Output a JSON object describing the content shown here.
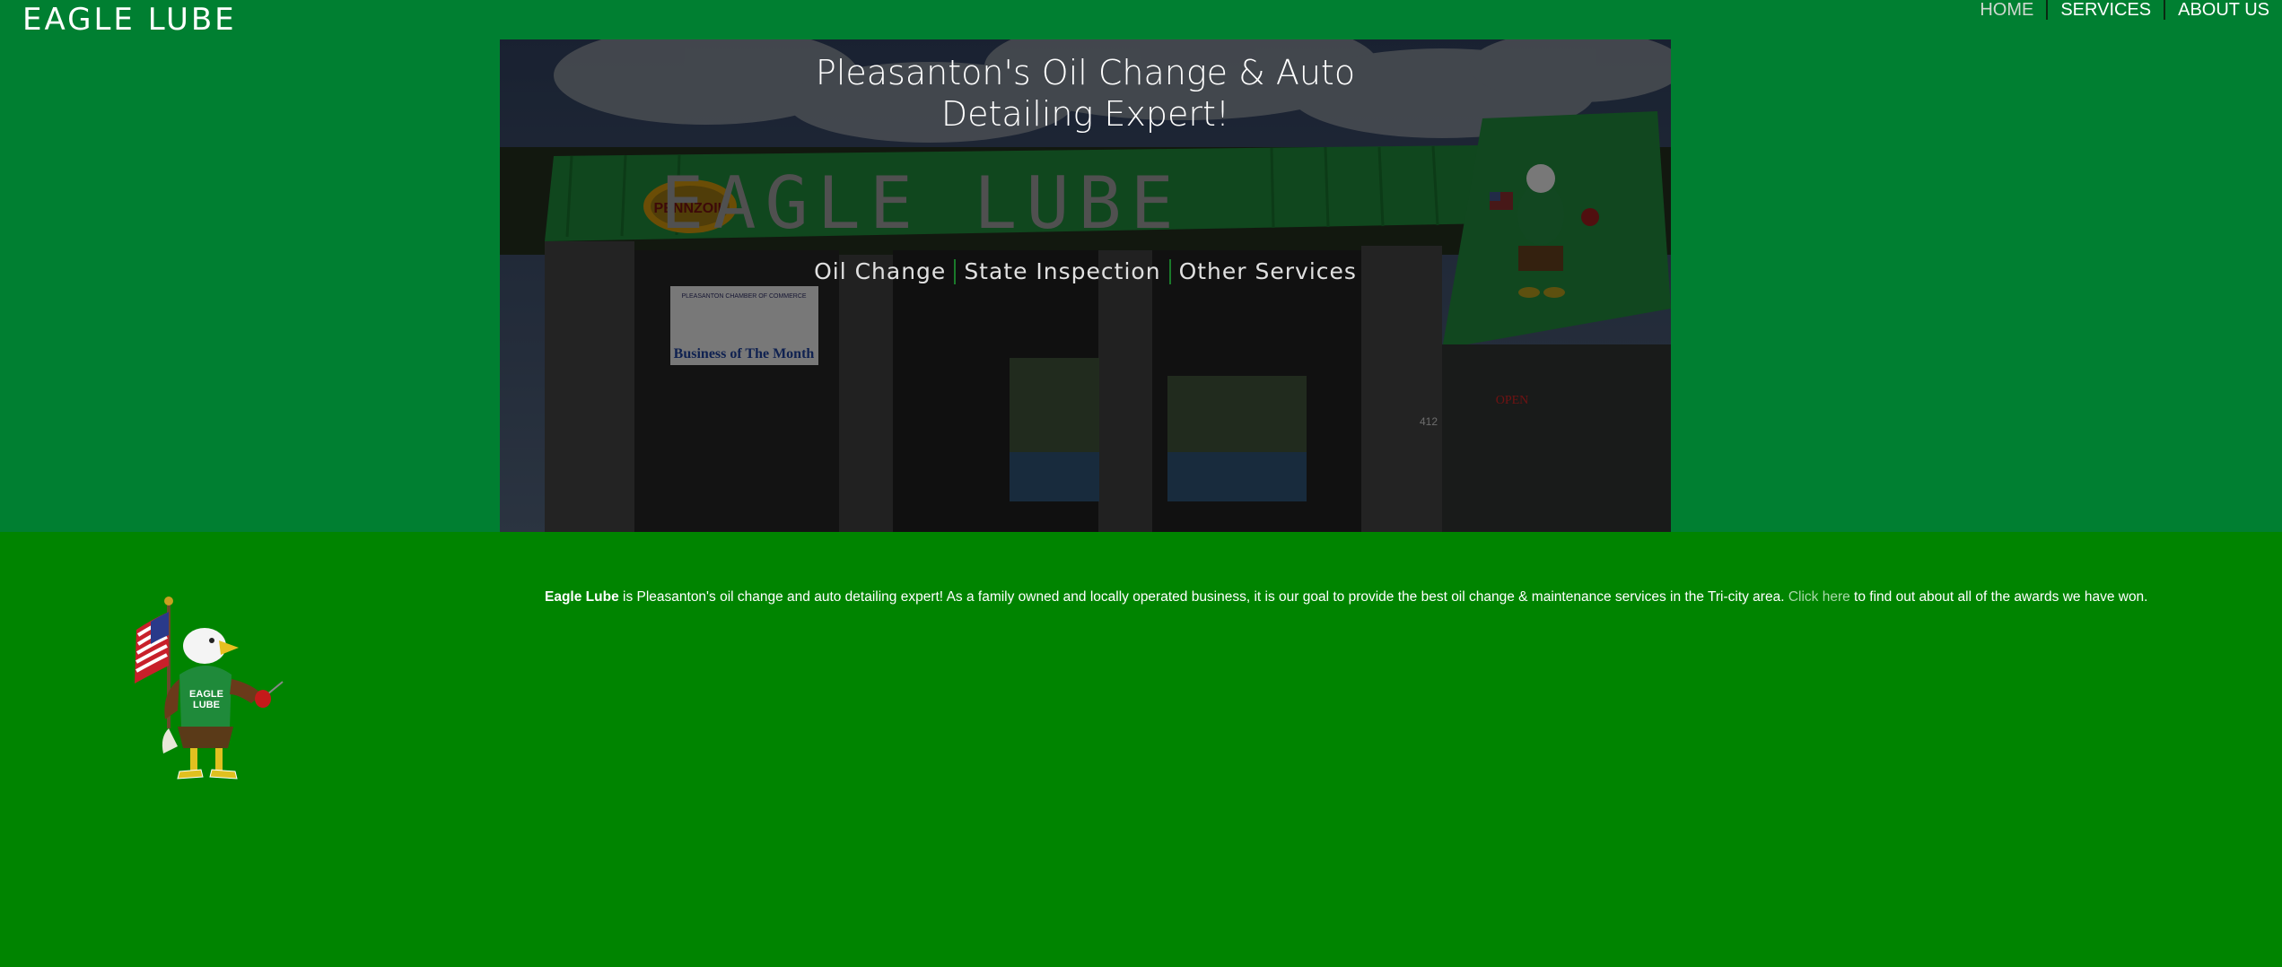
{
  "header": {
    "brand": "EAGLE LUBE",
    "nav": [
      {
        "label": "HOME",
        "active": true
      },
      {
        "label": "SERVICES",
        "active": false
      },
      {
        "label": "ABOUT US",
        "active": false
      }
    ]
  },
  "hero": {
    "title_line1": "Pleasanton's Oil Change & Auto",
    "title_line2": "Detailing Expert!",
    "links": [
      "Oil Change",
      "State Inspection",
      "Other Services"
    ],
    "photo": {
      "building_sign": "EAGLE LUBE",
      "logo_sign": "PENNZOIL",
      "banner_top": "PLEASANTON CHAMBER OF COMMERCE",
      "banner_main": "Business of The Month",
      "open_sign": "OPEN",
      "address": "412"
    }
  },
  "intro": {
    "company": "Eagle Lube",
    "text_before_link": " is Pleasanton's oil change and auto detailing expert! As a family owned and locally operated business, it is our goal to provide the best oil change & maintenance services in the Tri-city area. ",
    "link_text": "Click here",
    "text_after_link": " to find out about all of the awards we have won."
  },
  "mascot": {
    "shirt_text_line1": "EAGLE",
    "shirt_text_line2": "LUBE"
  },
  "colors": {
    "top_background": "#007f31",
    "body_background": "#008400",
    "roof_green": "#1d8a3a",
    "link": "#a8d8a8"
  },
  "icons": [
    "eagle-mascot-icon",
    "american-flag-icon",
    "oil-can-icon"
  ]
}
